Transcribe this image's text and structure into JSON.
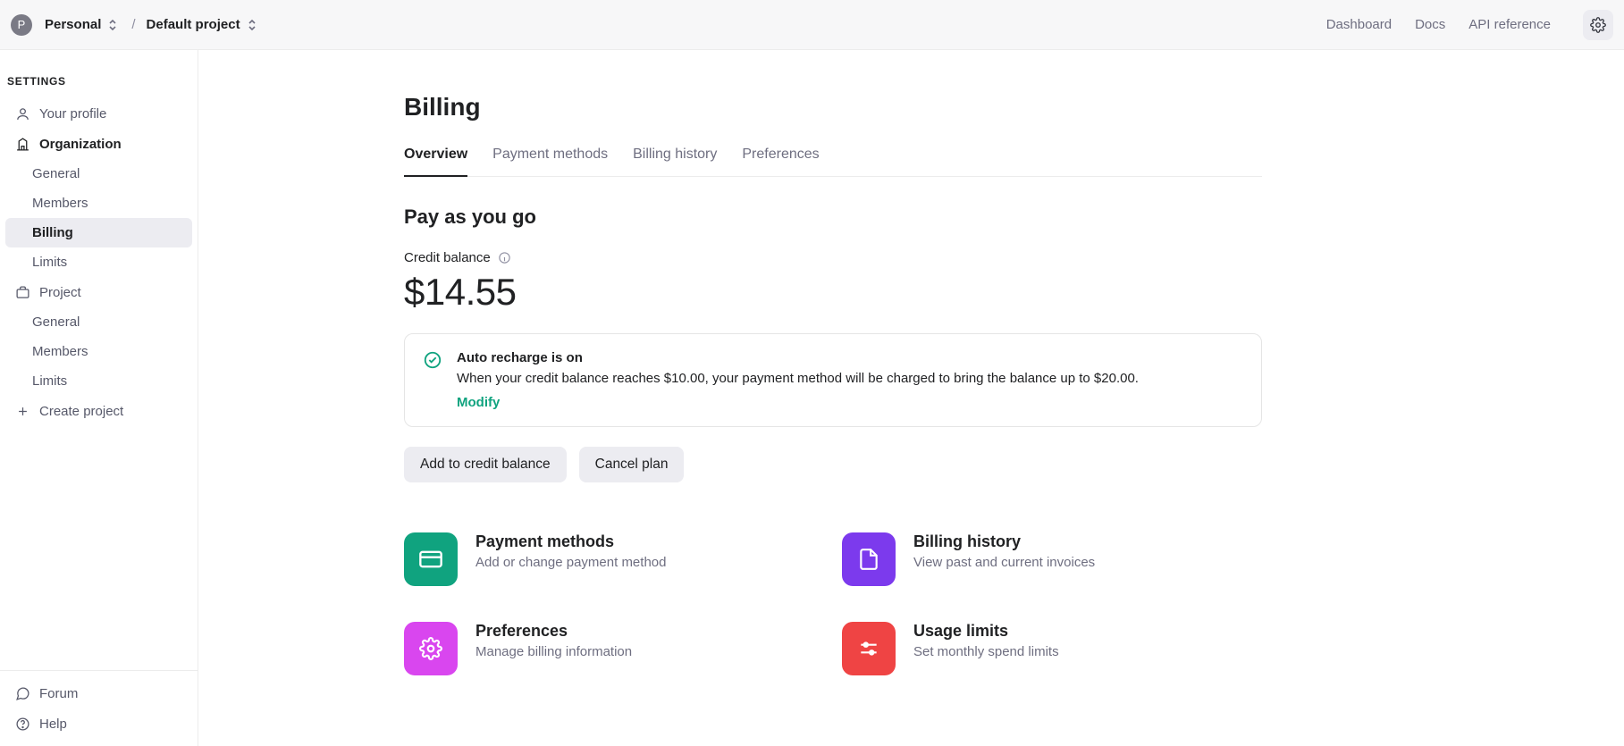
{
  "header": {
    "avatar_letter": "P",
    "breadcrumbs": [
      {
        "label": "Personal"
      },
      {
        "label": "Default project"
      }
    ],
    "nav": [
      {
        "label": "Dashboard"
      },
      {
        "label": "Docs"
      },
      {
        "label": "API reference"
      }
    ]
  },
  "sidebar": {
    "heading": "SETTINGS",
    "your_profile": "Your profile",
    "organization": "Organization",
    "org_items": [
      {
        "label": "General"
      },
      {
        "label": "Members"
      },
      {
        "label": "Billing",
        "active": true
      },
      {
        "label": "Limits"
      }
    ],
    "project": "Project",
    "project_items": [
      {
        "label": "General"
      },
      {
        "label": "Members"
      },
      {
        "label": "Limits"
      }
    ],
    "create_project": "Create project",
    "footer": [
      {
        "label": "Forum"
      },
      {
        "label": "Help"
      }
    ]
  },
  "page": {
    "title": "Billing",
    "tabs": [
      {
        "label": "Overview",
        "active": true
      },
      {
        "label": "Payment methods"
      },
      {
        "label": "Billing history"
      },
      {
        "label": "Preferences"
      }
    ],
    "section_title": "Pay as you go",
    "balance_label": "Credit balance",
    "balance_amount": "$14.55",
    "recharge_card": {
      "title": "Auto recharge is on",
      "desc": "When your credit balance reaches $10.00, your payment method will be charged to bring the balance up to $20.00.",
      "action": "Modify"
    },
    "buttons": {
      "add": "Add to credit balance",
      "cancel": "Cancel plan"
    },
    "tiles": [
      {
        "title": "Payment methods",
        "desc": "Add or change payment method",
        "color": "g-green",
        "icon": "card"
      },
      {
        "title": "Billing history",
        "desc": "View past and current invoices",
        "color": "g-purple",
        "icon": "file"
      },
      {
        "title": "Preferences",
        "desc": "Manage billing information",
        "color": "g-pink",
        "icon": "gear"
      },
      {
        "title": "Usage limits",
        "desc": "Set monthly spend limits",
        "color": "g-red",
        "icon": "sliders"
      }
    ]
  }
}
